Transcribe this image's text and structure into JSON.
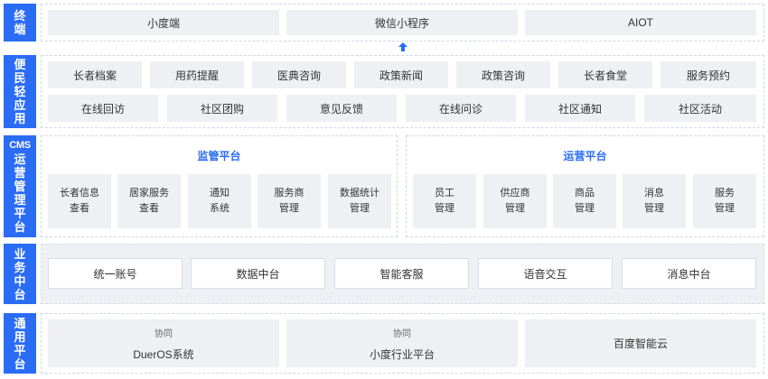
{
  "rows": {
    "terminal": {
      "label": "终端",
      "items": [
        "小度端",
        "微信小程序",
        "AIOT"
      ]
    },
    "services": {
      "label": "便民轻应用",
      "row1": [
        "长者档案",
        "用药提醒",
        "医典咨询",
        "政策新闻",
        "政策咨询",
        "长者食堂",
        "服务预约"
      ],
      "row2": [
        "在线回访",
        "社区团购",
        "意见反馈",
        "在线问诊",
        "社区通知",
        "社区活动"
      ]
    },
    "cms": {
      "label_top": "CMS",
      "label": "运营管理平台",
      "supervision": {
        "title": "监管平台",
        "tiles": [
          [
            "长者信息",
            "查看"
          ],
          [
            "居家服务",
            "查看"
          ],
          [
            "通知",
            "系统"
          ],
          [
            "服务商",
            "管理"
          ],
          [
            "数据统计",
            "管理"
          ]
        ]
      },
      "operation": {
        "title": "运营平台",
        "tiles": [
          [
            "员工",
            "管理"
          ],
          [
            "供应商",
            "管理"
          ],
          [
            "商品",
            "管理"
          ],
          [
            "消息",
            "管理"
          ],
          [
            "服务",
            "管理"
          ]
        ]
      }
    },
    "business": {
      "label": "业务中台",
      "items": [
        "统一账号",
        "数据中台",
        "智能客服",
        "语音交互",
        "消息中台"
      ]
    },
    "common": {
      "label": "通用平台",
      "items": [
        {
          "sub": "协同",
          "name": "DuerOS系统"
        },
        {
          "sub": "协同",
          "name": "小度行业平台"
        },
        {
          "sub": "",
          "name": "百度智能云"
        }
      ]
    }
  },
  "colors": {
    "accent": "#2a6cf6",
    "box_bg": "#eef0f3"
  },
  "icons": {
    "arrow": "arrow-up-icon"
  }
}
